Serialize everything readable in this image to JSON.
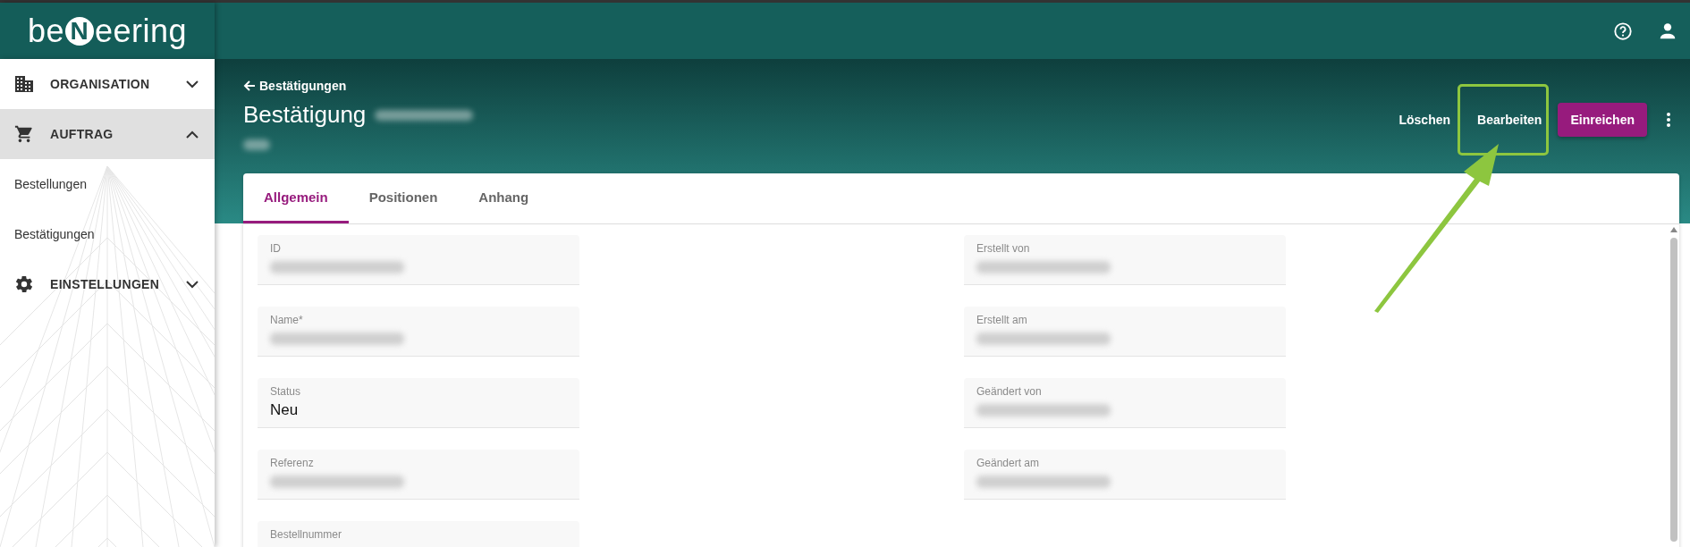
{
  "topbar": {
    "logo": {
      "before": "be",
      "mark": "N",
      "after": "eering"
    }
  },
  "sidebar": {
    "items": [
      {
        "kind": "group",
        "label": "ORGANISATION",
        "expanded": false,
        "selected": false
      },
      {
        "kind": "group",
        "label": "AUFTRAG",
        "expanded": true,
        "selected": true,
        "children": [
          {
            "label": "Bestellungen"
          },
          {
            "label": "Bestätigungen"
          }
        ]
      },
      {
        "kind": "group",
        "label": "EINSTELLUNGEN",
        "expanded": false,
        "selected": false
      }
    ]
  },
  "header": {
    "back_link": "Bestätigungen",
    "title": "Bestätigung",
    "title_hidden": true,
    "subtitle_hidden": true,
    "actions": [
      {
        "kind": "text",
        "label": "Löschen",
        "highlighted": false
      },
      {
        "kind": "text",
        "label": "Bearbeiten",
        "highlighted": true
      },
      {
        "kind": "primary",
        "label": "Einreichen",
        "highlighted": false
      },
      {
        "kind": "more"
      }
    ]
  },
  "tabs": [
    {
      "label": "Allgemein",
      "selected": true
    },
    {
      "label": "Positionen",
      "selected": false
    },
    {
      "label": "Anhang",
      "selected": false
    }
  ],
  "fields_left": [
    {
      "label": "ID",
      "value_hidden": true
    },
    {
      "label": "Name*",
      "value_hidden": true
    },
    {
      "label": "Status",
      "value": "Neu",
      "value_hidden": false
    },
    {
      "label": "Referenz",
      "value_hidden": true
    },
    {
      "label": "Bestellnummer"
    }
  ],
  "fields_right": [
    {
      "label": "Erstellt von",
      "value_hidden": true
    },
    {
      "label": "Erstellt am",
      "value_hidden": true
    },
    {
      "label": "Geändert von",
      "value_hidden": true
    },
    {
      "label": "Geändert am",
      "value_hidden": true
    }
  ]
}
